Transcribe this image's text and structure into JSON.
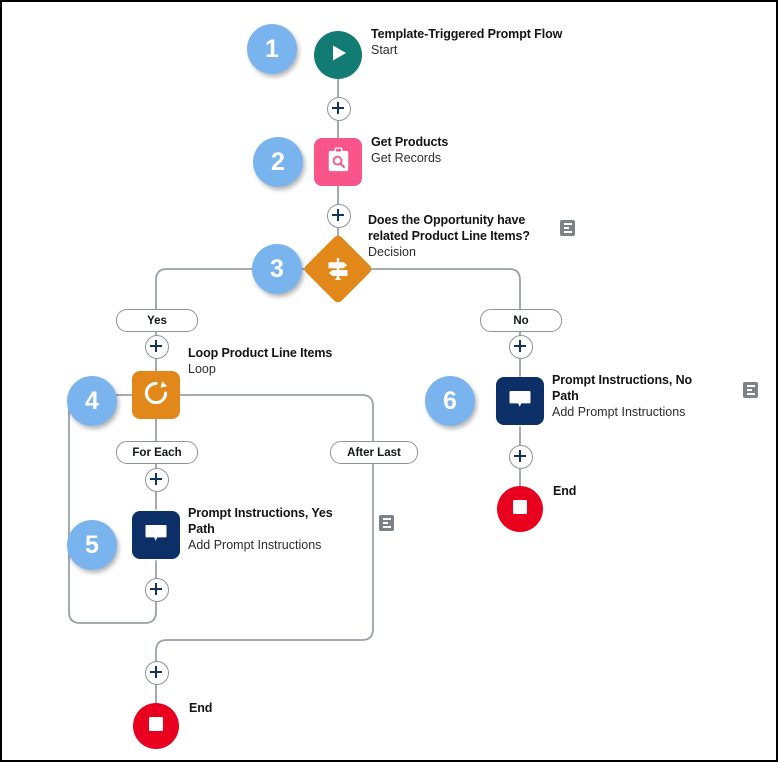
{
  "diagram": {
    "title": "Template-Triggered Prompt Flow",
    "type": "salesforce-flow-builder-canvas",
    "nodes": [
      {
        "step": "1",
        "name": "Template-Triggered Prompt Flow",
        "subtitle": "Start",
        "icon": "play-icon",
        "shape": "circle",
        "color": "#127B73",
        "has_note": false
      },
      {
        "step": "2",
        "name": "Get Products",
        "subtitle": "Get Records",
        "icon": "clipboard-search-icon",
        "shape": "rounded-square",
        "color": "#F9558A",
        "has_note": false
      },
      {
        "step": "3",
        "name": "Does the Opportunity have related Product Line Items?",
        "subtitle": "Decision",
        "icon": "signpost-icon",
        "shape": "diamond",
        "color": "#E2881A",
        "has_note": true
      },
      {
        "step": "4",
        "name": "Loop Product Line Items",
        "subtitle": "Loop",
        "icon": "refresh-loop-icon",
        "shape": "rounded-square",
        "color": "#E2881A",
        "has_note": false
      },
      {
        "step": "5",
        "name": "Prompt Instructions, Yes Path",
        "subtitle": "Add Prompt Instructions",
        "icon": "speech-bubble-icon",
        "shape": "rounded-square",
        "color": "#0B2F66",
        "has_note": true
      },
      {
        "step": "6",
        "name": "Prompt Instructions, No Path",
        "subtitle": "Add Prompt Instructions",
        "icon": "speech-bubble-icon",
        "shape": "rounded-square",
        "color": "#0B2F66",
        "has_note": true
      }
    ],
    "path_labels": {
      "yes": "Yes",
      "no": "No",
      "for_each": "For Each",
      "after_last": "After Last"
    },
    "end_nodes": [
      {
        "label": "End",
        "branch": "no-path"
      },
      {
        "label": "End",
        "branch": "yes-path"
      }
    ],
    "colors": {
      "badge": "#7AB4EF",
      "start": "#127B73",
      "get_records": "#F9558A",
      "decision": "#E2881A",
      "loop": "#E2881A",
      "prompt": "#0B2F66",
      "end": "#E8001E",
      "connector": "#9aa0a6",
      "plus": "#123260"
    }
  }
}
